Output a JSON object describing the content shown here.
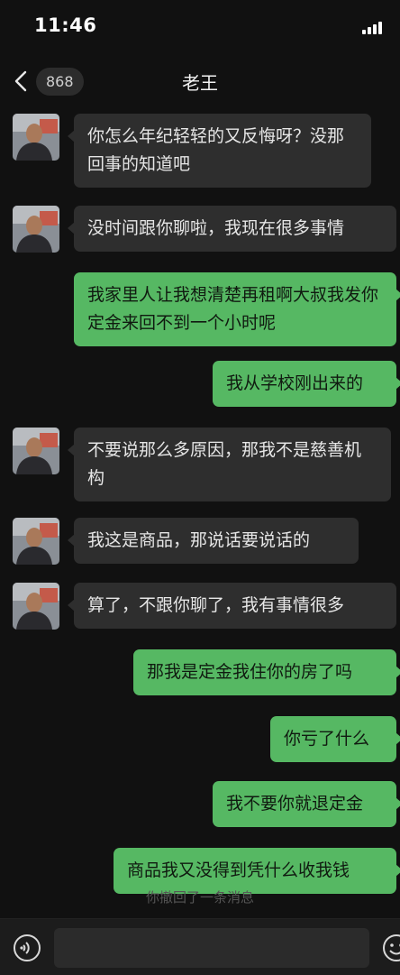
{
  "status": {
    "time": "11:46"
  },
  "header": {
    "back_count": "868",
    "title": "老王"
  },
  "messages": [
    {
      "side": "in",
      "text": "你怎么年纪轻轻的又反悔呀？没那回事的知道吧"
    },
    {
      "side": "in",
      "text": "没时间跟你聊啦，我现在很多事情"
    },
    {
      "side": "out",
      "text": "我家里人让我想清楚再租啊大叔我发你定金来回不到一个小时呢"
    },
    {
      "side": "out",
      "text": "我从学校刚出来的"
    },
    {
      "side": "in",
      "text": "不要说那么多原因，那我不是慈善机构"
    },
    {
      "side": "in",
      "text": "我这是商品，那说话要说话的"
    },
    {
      "side": "in",
      "text": "算了，不跟你聊了，我有事情很多"
    },
    {
      "side": "out",
      "text": "那我是定金我住你的房了吗"
    },
    {
      "side": "out",
      "text": "你亏了什么"
    },
    {
      "side": "out",
      "text": "我不要你就退定金"
    },
    {
      "side": "out",
      "text": "商品我又没得到凭什么收我钱"
    }
  ],
  "system_notice": "你撤回了一条消息",
  "colors": {
    "background": "#111111",
    "incoming_bubble": "#2e2e2e",
    "outgoing_bubble": "#56b863"
  },
  "icons": {
    "back": "chevron-left-icon",
    "voice": "voice-icon",
    "emoji": "emoji-icon",
    "signal": "signal-icon"
  }
}
